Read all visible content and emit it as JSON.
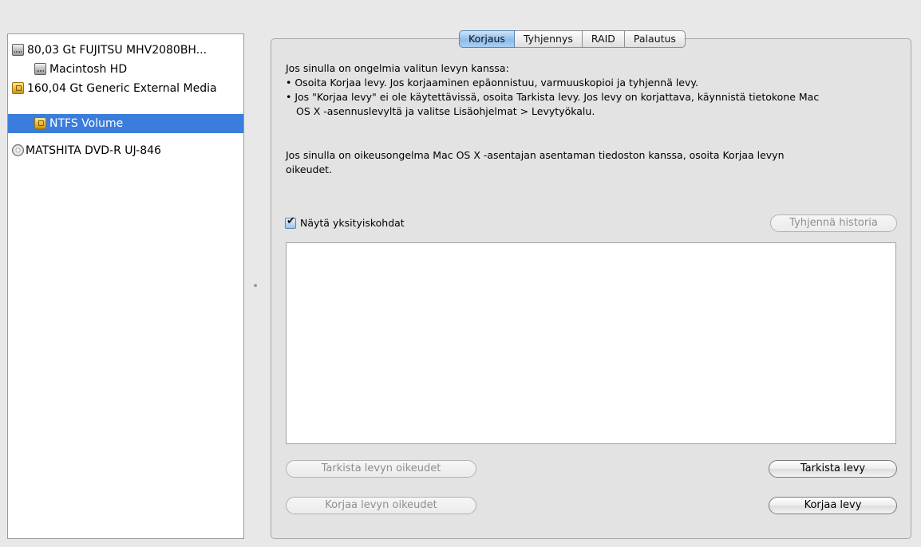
{
  "sidebar": {
    "items": [
      {
        "label": "80,03 Gt FUJITSU MHV2080BH...",
        "icon": "hdd-icon"
      },
      {
        "label": "Macintosh HD",
        "icon": "hdd-icon"
      },
      {
        "label": "160,04 Gt Generic External Media",
        "icon": "external-drive-icon"
      },
      {
        "label": "NTFS Volume",
        "icon": "external-drive-icon",
        "selected": true
      },
      {
        "label": "MATSHITA DVD-R UJ-846",
        "icon": "dvd-icon"
      }
    ]
  },
  "tabs": [
    {
      "label": "Korjaus",
      "active": true
    },
    {
      "label": "Tyhjennys"
    },
    {
      "label": "RAID"
    },
    {
      "label": "Palautus"
    }
  ],
  "info": {
    "line1": "Jos sinulla on ongelmia valitun levyn kanssa:",
    "bullet1": "•  Osoita Korjaa levy. Jos korjaaminen epäonnistuu, varmuuskopioi ja tyhjennä levy.",
    "bullet2a": "•  Jos \"Korjaa levy\" ei ole käytettävissä, osoita Tarkista levy. Jos levy on korjattava, käynnistä tietokone Mac",
    "bullet2b": "OS X -asennuslevyltä ja valitse Lisäohjelmat > Levytyökalu.",
    "perm_a": "Jos sinulla on oikeusongelma Mac OS X -asentajan asentaman tiedoston kanssa, osoita Korjaa levyn",
    "perm_b": "oikeudet."
  },
  "details": {
    "checkbox_label": "Näytä yksityiskohdat",
    "checked": true,
    "clear_history": "Tyhjennä historia"
  },
  "buttons": {
    "verify_permissions": "Tarkista levyn oikeudet",
    "repair_permissions": "Korjaa levyn oikeudet",
    "verify_disk": "Tarkista levy",
    "repair_disk": "Korjaa levy"
  },
  "colors": {
    "selection": "#3b7ddc",
    "active_tab": "#8ebce9"
  }
}
